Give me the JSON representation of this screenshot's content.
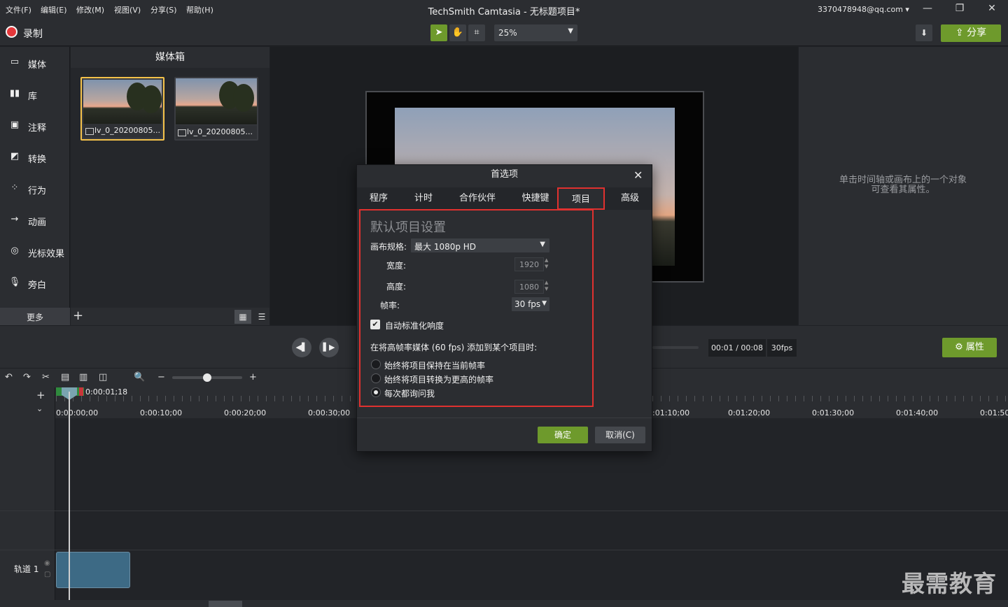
{
  "menu": [
    "文件(F)",
    "编辑(E)",
    "修改(M)",
    "视图(V)",
    "分享(S)",
    "帮助(H)"
  ],
  "app_title": "TechSmith Camtasia - 无标题项目*",
  "account": "3370478948@qq.com ▾",
  "window_controls": [
    "—",
    "❐",
    "✕"
  ],
  "toolbar": {
    "record_label": "录制",
    "zoom_value": "25%",
    "share_label": "分享"
  },
  "sidebar": {
    "items": [
      {
        "label": "媒体",
        "icon": "media-icon"
      },
      {
        "label": "库",
        "icon": "library-icon"
      },
      {
        "label": "注释",
        "icon": "annotation-icon"
      },
      {
        "label": "转换",
        "icon": "transition-icon"
      },
      {
        "label": "行为",
        "icon": "behavior-icon"
      },
      {
        "label": "动画",
        "icon": "animation-icon"
      },
      {
        "label": "光标效果",
        "icon": "cursor-effect-icon"
      },
      {
        "label": "旁白",
        "icon": "microphone-icon"
      }
    ],
    "more_label": "更多"
  },
  "media_bin": {
    "title": "媒体箱",
    "clips": [
      {
        "name": "lv_0_20200805..."
      },
      {
        "name": "lv_0_20200805..."
      }
    ]
  },
  "properties_hint": "单击时间轴或画布上的一个对象\n可查看其属性。",
  "playback": {
    "time": "00:01 / 00:08",
    "fps": "30fps",
    "properties_label": "属性"
  },
  "timeline": {
    "playhead_time": "0:00:01;18",
    "ruler_labels": [
      "0:00:00;00",
      "0:00:10;00",
      "0:00:20;00",
      "0:00:30;00",
      "0:01:10;00",
      "0:01:20;00",
      "0:01:30;00",
      "0:01:40;00",
      "0:01:50;"
    ],
    "track_label": "轨道 1"
  },
  "dialog": {
    "title": "首选项",
    "tabs": [
      "程序",
      "计时",
      "合作伙伴",
      "快捷键",
      "项目",
      "高级"
    ],
    "active_tab": "项目",
    "section_title": "默认项目设置",
    "canvas_label": "画布规格:",
    "canvas_value": "最大 1080p HD",
    "width_label": "宽度:",
    "width_value": "1920",
    "height_label": "高度:",
    "height_value": "1080",
    "fps_label": "帧率:",
    "fps_value": "30 fps",
    "normalize_label": "自动标准化响度",
    "normalize_checked": true,
    "hfr_label": "在将高帧率媒体 (60 fps) 添加到某个项目时:",
    "radio_options": [
      "始终将项目保持在当前帧率",
      "始终将项目转换为更高的帧率",
      "每次都询问我"
    ],
    "radio_selected": 2,
    "ok_label": "确定",
    "cancel_label": "取消(C)"
  },
  "watermark": "最需教育",
  "colors": {
    "accent": "#6e9a2c",
    "highlight": "#e0312f",
    "selection": "#f4c24a"
  }
}
